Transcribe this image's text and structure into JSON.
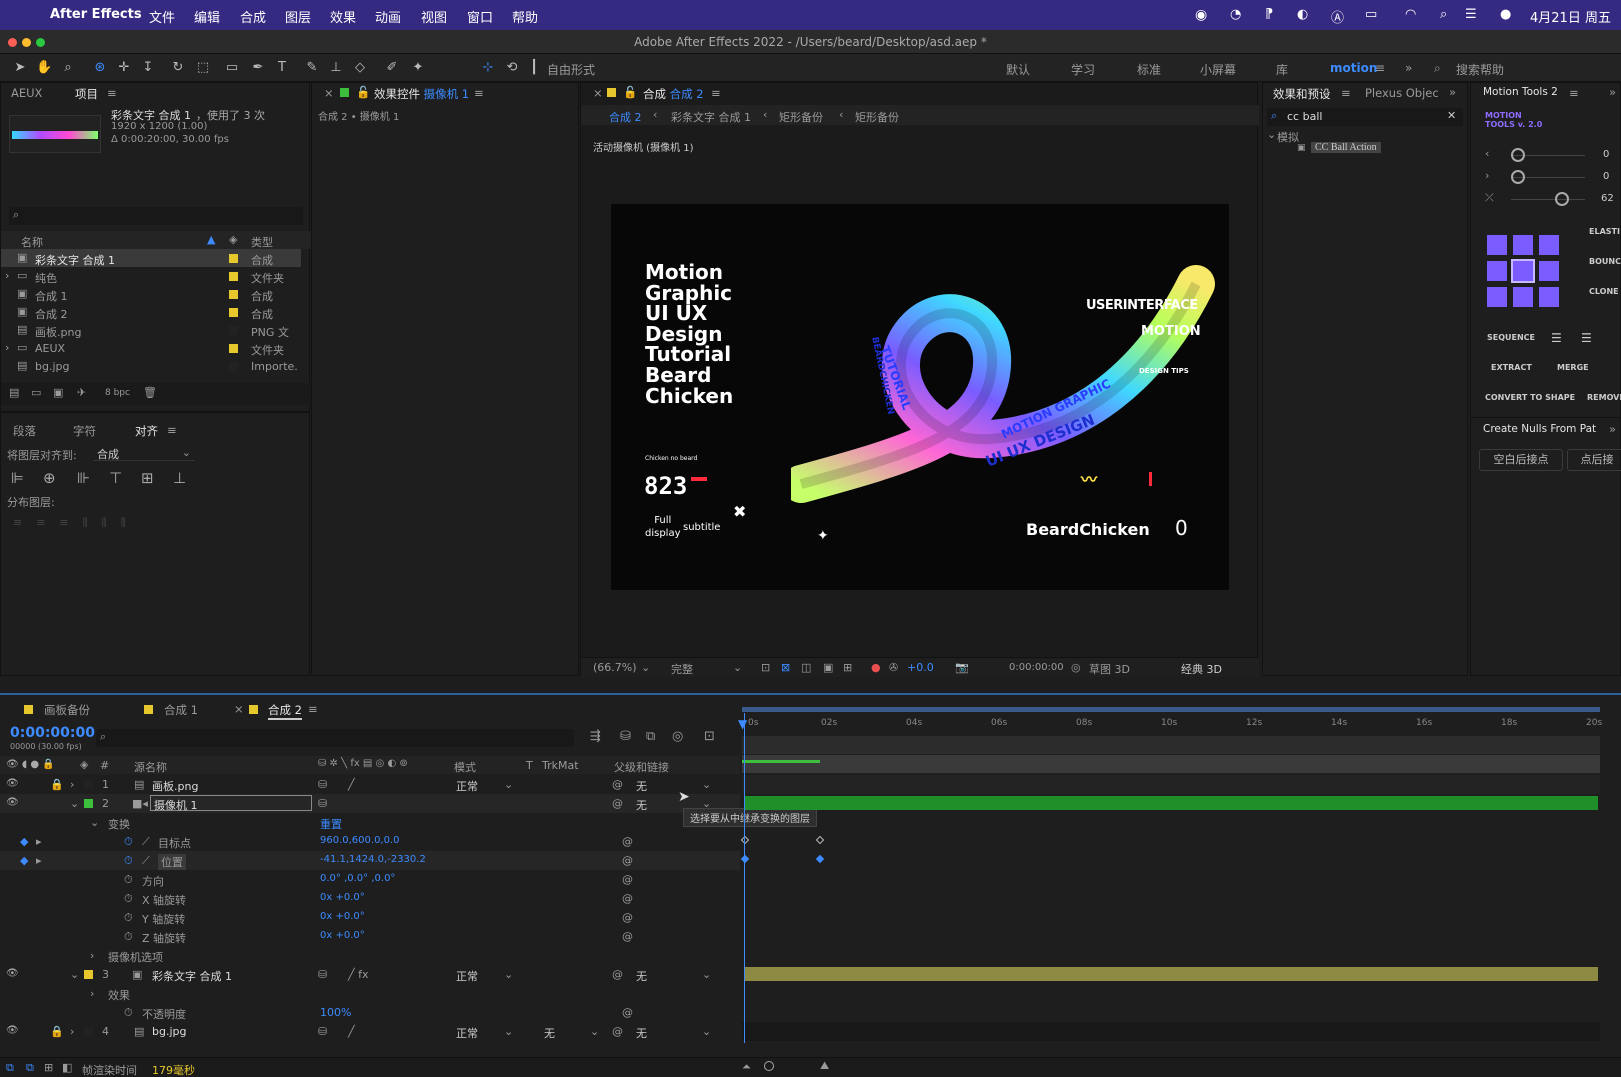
{
  "menubar": {
    "app": "After Effects",
    "items": [
      "文件",
      "编辑",
      "合成",
      "图层",
      "效果",
      "动画",
      "视图",
      "窗口",
      "帮助"
    ],
    "clock": "4月21日 周五"
  },
  "window_title": "Adobe After Effects 2022 - /Users/beard/Desktop/asd.aep *",
  "toolbar": {
    "free_form": "自由形式",
    "workspaces": [
      "默认",
      "学习",
      "标准",
      "小屏幕",
      "库",
      "motion"
    ],
    "search_help": "搜索帮助"
  },
  "project_panel": {
    "tabs": [
      "AEUX",
      "项目"
    ],
    "selected_name": "彩条文字 合成 1",
    "used_times": "，使用了 3 次",
    "resolution": "1920 x 1200 (1.00)",
    "duration": "Δ 0:00:20:00, 30.00 fps",
    "col_name": "名称",
    "col_type": "类型",
    "items": [
      {
        "name": "彩条文字 合成 1",
        "type": "合成",
        "color": "#e6c72c"
      },
      {
        "name": "纯色",
        "type": "文件夹",
        "color": "#e6c72c"
      },
      {
        "name": "合成 1",
        "type": "合成",
        "color": "#e6c72c"
      },
      {
        "name": "合成 2",
        "type": "合成",
        "color": "#e6c72c"
      },
      {
        "name": "画板.png",
        "type": "PNG 文",
        "color": "#222222"
      },
      {
        "name": "AEUX",
        "type": "文件夹",
        "color": "#e6c72c"
      },
      {
        "name": "bg.jpg",
        "type": "Importe.",
        "color": "#222222"
      }
    ],
    "bpc": "8 bpc"
  },
  "align_panel": {
    "tabs": [
      "段落",
      "字符",
      "对齐"
    ],
    "align_to_label": "将图层对齐到:",
    "align_to_value": "合成",
    "distribute_label": "分布图层:"
  },
  "effect_controls": {
    "tab_prefix": "效果控件",
    "tab_layer": "摄像机 1",
    "breadcrumb": "合成 2 • 摄像机 1"
  },
  "composition": {
    "tab_prefix": "合成",
    "tab_name": "合成 2",
    "breadcrumbs": [
      "合成 2",
      "彩条文字 合成 1",
      "矩形备份",
      "矩形备份"
    ],
    "active_camera": "活动摄像机 (摄像机 1)",
    "canvas": {
      "title_lines": [
        "Motion",
        "Graphic",
        "UI UX",
        "Design",
        "Tutorial",
        "Beard",
        "Chicken"
      ],
      "small_label": "Chicken no beard",
      "number": "823",
      "full_display": "Full\ndisplay",
      "subtitle": "subtitle",
      "right_title": "USERINTERFACE",
      "right_motion": "MOTION",
      "right_small": "DESIGN TIPS",
      "brand": "BeardChicken",
      "zero": "0",
      "ribbon_text_1": "TUTORIAL",
      "ribbon_text_2": "BEARDCHICKEN",
      "ribbon_text_3": "MOTION GRAPHIC",
      "ribbon_text_4": "UI UX DESIGN"
    },
    "footer": {
      "zoom": "(66.7%)",
      "quality": "完整",
      "exposure": "+0.0",
      "timecode": "0:00:00:00",
      "draft3d": "草图 3D",
      "renderer": "经典 3D"
    }
  },
  "effects_presets": {
    "tabs": [
      "效果和预设",
      "Plexus Objec"
    ],
    "search": "cc ball",
    "category": "模拟",
    "result": "CC Ball Action"
  },
  "motion_tools": {
    "tab": "Motion Tools 2",
    "logo": "MOTION\nTOOLS v. 2.0",
    "values": [
      "0",
      "0",
      "62"
    ],
    "labels": [
      "ELASTI",
      "BOUNC",
      "CLONE",
      "SEQUENCE",
      "EXTRACT",
      "MERGE",
      "CONVERT TO SHAPE",
      "REMOVE"
    ],
    "nulls_tab": "Create Nulls From Pat",
    "nulls_buttons": [
      "空白后接点",
      "点后接"
    ]
  },
  "timeline": {
    "tabs": [
      "画板备份",
      "合成 1",
      "合成 2"
    ],
    "timecode": "0:00:00:00",
    "fps": "00000 (30.00 fps)",
    "headers": {
      "name": "源名称",
      "mode": "模式",
      "t": "T",
      "trkmat": "TrkMat",
      "parent": "父级和链接"
    },
    "ruler": [
      "0s",
      "02s",
      "04s",
      "06s",
      "08s",
      "10s",
      "12s",
      "14s",
      "16s",
      "18s",
      "20s"
    ],
    "layers": [
      {
        "num": "1",
        "name": "画板.png",
        "mode": "正常",
        "parent": "无"
      },
      {
        "num": "2",
        "name": "摄像机 1",
        "parent": "无"
      },
      {
        "num": "3",
        "name": "彩条文字 合成 1",
        "mode": "正常",
        "parent": "无"
      },
      {
        "num": "4",
        "name": "bg.jpg",
        "mode": "正常",
        "trkmat": "无",
        "parent": "无"
      }
    ],
    "transform": {
      "group": "变换",
      "reset": "重置",
      "props": [
        {
          "name": "目标点",
          "value": "960.0,600.0,0.0"
        },
        {
          "name": "位置",
          "value": "-41.1,1424.0,-2330.2"
        },
        {
          "name": "方向",
          "value": "0.0° ,0.0° ,0.0°"
        },
        {
          "name": "X 轴旋转",
          "value": "0x +0.0°"
        },
        {
          "name": "Y 轴旋转",
          "value": "0x +0.0°"
        },
        {
          "name": "Z 轴旋转",
          "value": "0x +0.0°"
        }
      ],
      "camera_options": "摄像机选项"
    },
    "effects_group": "效果",
    "opacity_label": "不透明度",
    "opacity_value": "100%",
    "tooltip": "选择要从中继承变换的图层",
    "render_time_label": "帧渲染时间",
    "render_time_value": "179毫秒"
  }
}
